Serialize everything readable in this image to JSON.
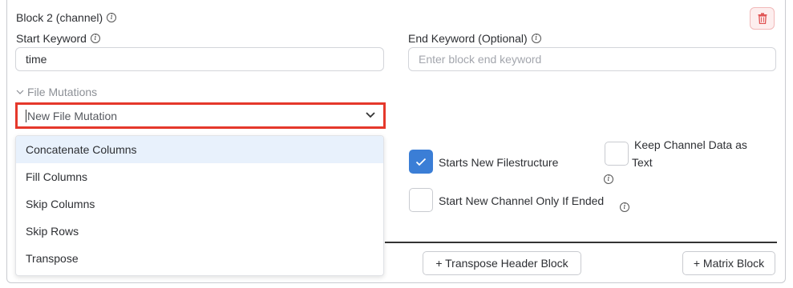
{
  "block": {
    "title": "Block 2 (channel)",
    "info_icon": "info-icon",
    "delete_icon": "trash-icon"
  },
  "start_keyword": {
    "label": "Start Keyword",
    "value": "time"
  },
  "end_keyword": {
    "label": "End Keyword (Optional)",
    "placeholder": "Enter block end keyword"
  },
  "file_mutations": {
    "section_label": "File Mutations",
    "select_value": "New File Mutation",
    "options": [
      "Concatenate Columns",
      "Fill Columns",
      "Skip Columns",
      "Skip Rows",
      "Transpose"
    ],
    "highlighted_index": 0
  },
  "options": {
    "starts_new_filestructure": {
      "label": "Starts New Filestructure",
      "checked": true
    },
    "keep_channel_text": {
      "label_line1": "Keep Channel Data as",
      "label_line2": "Text",
      "checked": false
    },
    "start_new_channel_if_ended": {
      "label": "Start New Channel Only If Ended",
      "checked": false
    }
  },
  "buttons": {
    "transpose_header": "+ Transpose Header Block",
    "matrix_block": "+ Matrix Block"
  },
  "colors": {
    "accent": "#3b7ed6",
    "highlight_border": "#e5382b",
    "danger_bg": "#fdeeee",
    "danger": "#e05252"
  }
}
